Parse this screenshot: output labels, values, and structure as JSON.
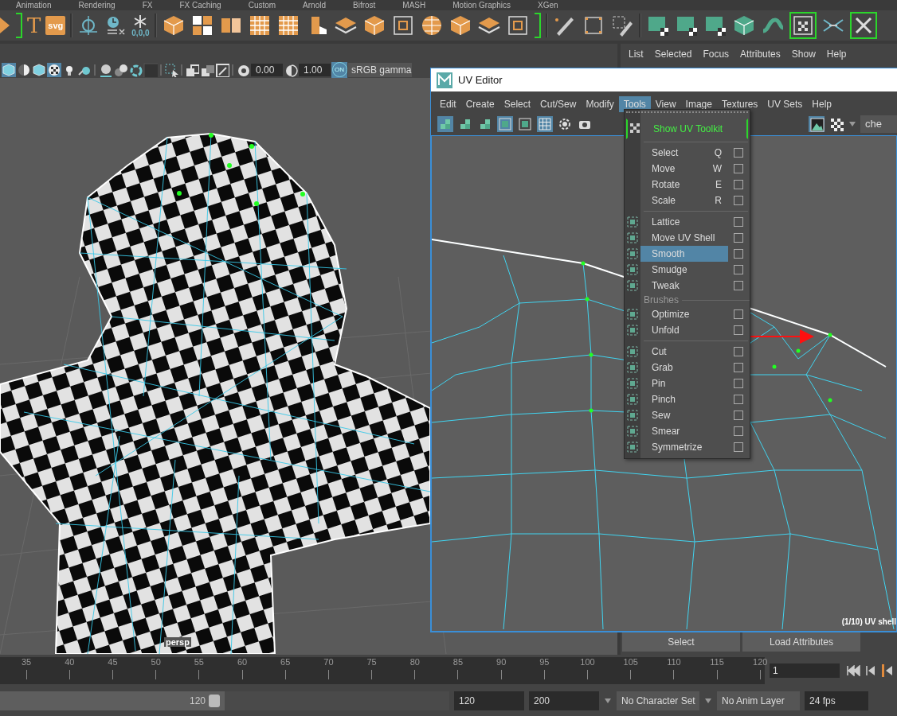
{
  "shelf_tabs": [
    "Animation",
    "Rendering",
    "FX",
    "FX Caching",
    "Custom",
    "Arnold",
    "Bifrost",
    "MASH",
    "Motion Graphics",
    "XGen"
  ],
  "shelf": {
    "text_icon": "T",
    "svg_icon": "svg",
    "coord_icon": "0,0,0"
  },
  "viewport": {
    "toolbar_buttons": [
      {
        "active": true
      },
      {
        "active": false
      },
      {
        "active": false
      },
      {
        "active": true
      },
      {
        "active": false
      },
      {
        "active": false
      }
    ],
    "exposure": "0.00",
    "gamma": "1.00",
    "toggle": "ON",
    "toggle_on": true,
    "color_space": "sRGB gamma",
    "camera": "persp"
  },
  "attribute_editor": {
    "menus": [
      "List",
      "Selected",
      "Focus",
      "Attributes",
      "Show",
      "Help"
    ],
    "buttons": [
      "Select",
      "Load Attributes"
    ]
  },
  "uv_editor": {
    "title": "UV Editor",
    "menus": [
      {
        "label": "Edit",
        "selected": false
      },
      {
        "label": "Create",
        "selected": false
      },
      {
        "label": "Select",
        "selected": false
      },
      {
        "label": "Cut/Sew",
        "selected": false
      },
      {
        "label": "Modify",
        "selected": false
      },
      {
        "label": "Tools",
        "selected": true
      },
      {
        "label": "View",
        "selected": false
      },
      {
        "label": "Image",
        "selected": false
      },
      {
        "label": "Textures",
        "selected": false
      },
      {
        "label": "UV Sets",
        "selected": false
      },
      {
        "label": "Help",
        "selected": false
      }
    ],
    "toolbar_buttons": [
      {
        "active": true
      },
      {
        "active": false
      },
      {
        "active": false
      },
      {
        "active": true
      },
      {
        "active": false
      },
      {
        "active": true
      },
      {
        "active": false
      },
      {
        "active": false
      }
    ],
    "texture_field": "che",
    "status": "(1/10) UV shell"
  },
  "tools_menu": {
    "toolkit": "Show UV Toolkit",
    "groups": [
      {
        "icons": false,
        "items": [
          {
            "label": "Select",
            "shortcut": "Q",
            "checked": false,
            "selected": false
          },
          {
            "label": "Move",
            "shortcut": "W",
            "checked": false,
            "selected": false
          },
          {
            "label": "Rotate",
            "shortcut": "E",
            "checked": false,
            "selected": false
          },
          {
            "label": "Scale",
            "shortcut": "R",
            "checked": false,
            "selected": false
          }
        ]
      },
      {
        "icons": true,
        "items": [
          {
            "label": "Lattice",
            "checked": false,
            "selected": false
          },
          {
            "label": "Move UV Shell",
            "checked": false,
            "selected": false
          },
          {
            "label": "Smooth",
            "checked": false,
            "selected": true
          },
          {
            "label": "Smudge",
            "checked": false,
            "selected": false
          },
          {
            "label": "Tweak",
            "checked": false,
            "selected": false
          }
        ]
      },
      {
        "icons": true,
        "heading": "Brushes",
        "items": [
          {
            "label": "Optimize",
            "checked": false,
            "selected": false
          },
          {
            "label": "Unfold",
            "checked": false,
            "selected": false
          }
        ]
      },
      {
        "icons": true,
        "items": [
          {
            "label": "Cut",
            "checked": false,
            "selected": false
          },
          {
            "label": "Grab",
            "checked": false,
            "selected": false
          },
          {
            "label": "Pin",
            "checked": false,
            "selected": false
          },
          {
            "label": "Pinch",
            "checked": false,
            "selected": false
          },
          {
            "label": "Sew",
            "checked": false,
            "selected": false
          },
          {
            "label": "Smear",
            "checked": false,
            "selected": false
          },
          {
            "label": "Symmetrize",
            "checked": false,
            "selected": false
          }
        ]
      }
    ]
  },
  "timeline": {
    "ticks": [
      "35",
      "40",
      "45",
      "50",
      "55",
      "60",
      "65",
      "70",
      "75",
      "80",
      "85",
      "90",
      "95",
      "100",
      "105",
      "110",
      "115",
      "120"
    ],
    "current_frame": "1"
  },
  "range": {
    "level": 0.5,
    "slider_end": "120",
    "start": "120",
    "end": "200",
    "character_set": "No Character Set",
    "anim_layer": "No Anim Layer",
    "fps": "24 fps"
  }
}
